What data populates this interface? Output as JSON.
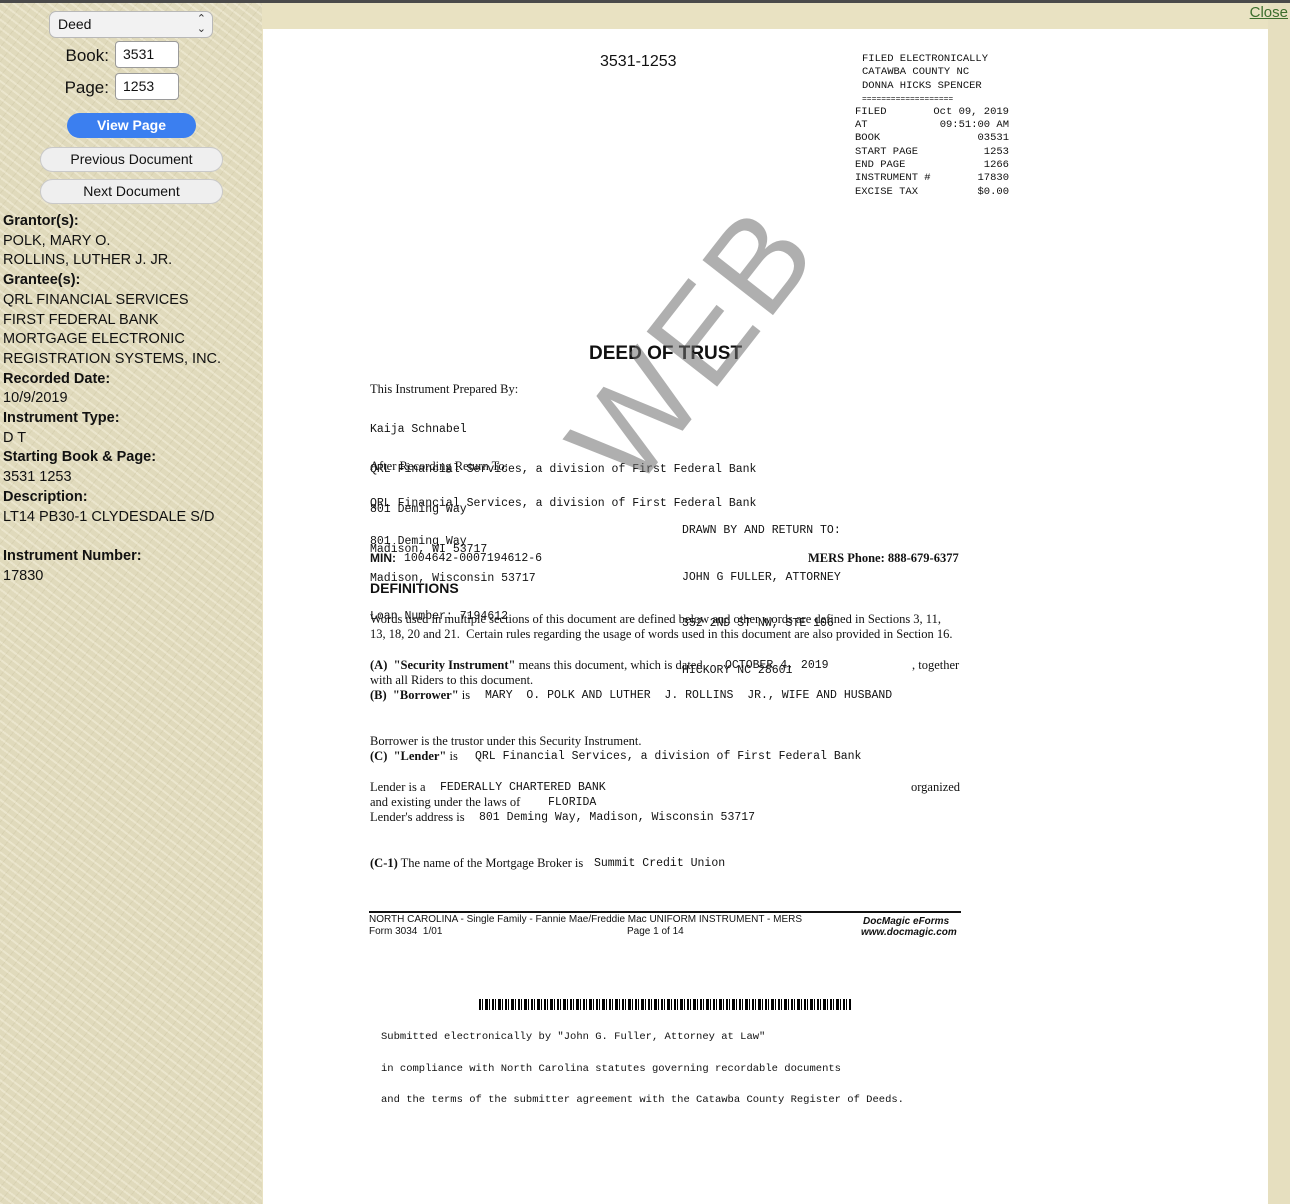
{
  "window": {
    "close_label": "Close"
  },
  "sidebar": {
    "doc_type_select": "Deed",
    "book_label": "Book:",
    "book_value": "3531",
    "page_label": "Page:",
    "page_value": "1253",
    "view_page_button": "View Page",
    "prev_button": "Previous Document",
    "next_button": "Next Document",
    "grantor_heading": "Grantor(s):",
    "grantors": [
      "POLK, MARY O.",
      "ROLLINS, LUTHER J. JR."
    ],
    "grantee_heading": "Grantee(s):",
    "grantees": [
      "QRL FINANCIAL SERVICES",
      "FIRST FEDERAL BANK",
      "MORTGAGE ELECTRONIC",
      "REGISTRATION SYSTEMS, INC."
    ],
    "recorded_date_heading": "Recorded Date:",
    "recorded_date": "10/9/2019",
    "instrument_type_heading": "Instrument Type:",
    "instrument_type": "D T",
    "starting_book_page_heading": "Starting Book & Page:",
    "starting_book_page": "3531 1253",
    "description_heading": "Description:",
    "description": "LT14 PB30-1 CLYDESDALE S/D",
    "instrument_number_heading": "Instrument Number:",
    "instrument_number": "17830"
  },
  "document": {
    "page_number": "3531-1253",
    "filed_stamp": {
      "line1": "FILED ELECTRONICALLY",
      "line2": "CATAWBA COUNTY NC",
      "line3": "DONNA HICKS SPENCER",
      "separator": "===================",
      "rows": [
        [
          "FILED",
          "Oct 09, 2019"
        ],
        [
          "AT",
          "09:51:00 AM"
        ],
        [
          "BOOK",
          "03531"
        ],
        [
          "START PAGE",
          "1253"
        ],
        [
          "END PAGE",
          "1266"
        ],
        [
          "INSTRUMENT #",
          "17830"
        ],
        [
          "EXCISE TAX",
          "$0.00"
        ]
      ]
    },
    "title": "DEED OF TRUST",
    "prepared_by_label": "This Instrument Prepared By:",
    "prepared_by_lines": [
      "Kaija Schnabel",
      "QRL Financial Services, a division of First Federal Bank",
      "801 Deming Way",
      "Madison, WI 53717"
    ],
    "return_to_label": "After Recording Return To:",
    "return_to_lines": [
      "QRL Financial Services, a division of First Federal Bank",
      "801 Deming Way",
      "Madison, Wisconsin 53717",
      "Loan Number: 7194612"
    ],
    "drawn_by_lines": [
      "DRAWN BY AND RETURN TO:",
      "JOHN G FULLER, ATTORNEY",
      "352 2ND ST NW, STE 106",
      "HICKORY NC 28601"
    ],
    "min_label": "MIN:",
    "min_value": "1004642-0007194612-6",
    "mers_phone": "MERS Phone: 888-679-6377",
    "definitions_heading": "DEFINITIONS",
    "definitions_text_1": "Words used in multiple sections of this document are defined below and other words are defined in Sections 3, 11,",
    "definitions_text_2": "13, 18, 20 and 21.  Certain rules regarding the usage of words used in this document are also provided in Section 16.",
    "a_label": "(A)",
    "a_term": "\"Security Instrument\"",
    "a_text": "means this document, which is dated",
    "a_date": "OCTOBER 4, 2019",
    "a_together": ", together",
    "a_text_2": "with all Riders to this document.",
    "b_label": "(B)",
    "b_term": "\"Borrower\"",
    "b_is": "is",
    "b_value": "MARY  O. POLK AND LUTHER  J. ROLLINS  JR., WIFE AND HUSBAND",
    "b_text_2": "Borrower is the trustor under this Security Instrument.",
    "c_label": "(C)",
    "c_term": "\"Lender\"",
    "c_is": "is",
    "c_value": "QRL Financial Services, a division of First Federal Bank",
    "lender_is_a": "Lender is a",
    "lender_type": "FEDERALLY CHARTERED BANK",
    "organized": "organized",
    "existing_under": "and existing under the laws of",
    "lender_state": "FLORIDA",
    "lender_address_label": "Lender's address is",
    "lender_address": "801 Deming Way, Madison, Wisconsin 53717",
    "c1_label": "(C-1)",
    "c1_text": "The name of the Mortgage Broker is",
    "c1_value": "Summit Credit Union",
    "footer_line1": "NORTH CAROLINA - Single Family - Fannie Mae/Freddie Mac UNIFORM INSTRUMENT - MERS",
    "footer_form": "Form 3034  1/01",
    "footer_page": "Page 1 of 14",
    "docmagic_brand": "DocMagic eForms",
    "docmagic_url": "www.docmagic.com",
    "watermark": "WEB",
    "submitted_1": "Submitted electronically by \"John G. Fuller, Attorney at Law\"",
    "submitted_2": "in compliance with North Carolina statutes governing recordable documents",
    "submitted_3": "and the terms of the submitter agreement with the Catawba County Register of Deeds."
  }
}
